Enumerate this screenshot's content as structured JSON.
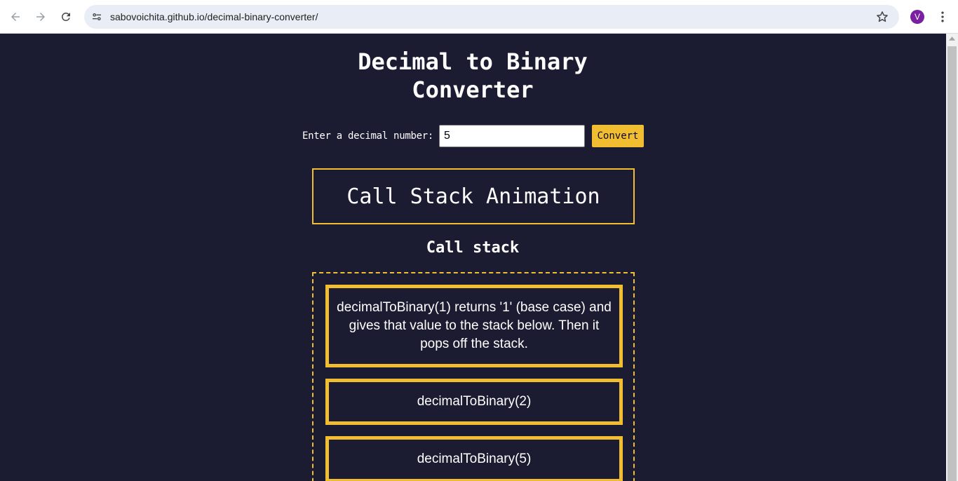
{
  "browser": {
    "url": "sabovoichita.github.io/decimal-binary-converter/",
    "profile_initial": "V",
    "icons": [
      "back-arrow-icon",
      "forward-arrow-icon",
      "reload-icon",
      "site-info-icon",
      "star-icon",
      "kebab-menu-icon"
    ]
  },
  "page": {
    "title": "Decimal to Binary Converter",
    "form": {
      "label": "Enter a decimal number:",
      "input_value": "5",
      "button_label": "Convert"
    },
    "animation_box": "Call Stack Animation",
    "stack_heading": "Call stack",
    "frames": [
      "decimalToBinary(1) returns '1' (base case) and gives that value to the stack below. Then it pops off the stack.",
      "decimalToBinary(2)",
      "decimalToBinary(5)"
    ]
  },
  "colors": {
    "background": "#1b1b32",
    "accent": "#f1be32",
    "text": "#ffffff"
  }
}
